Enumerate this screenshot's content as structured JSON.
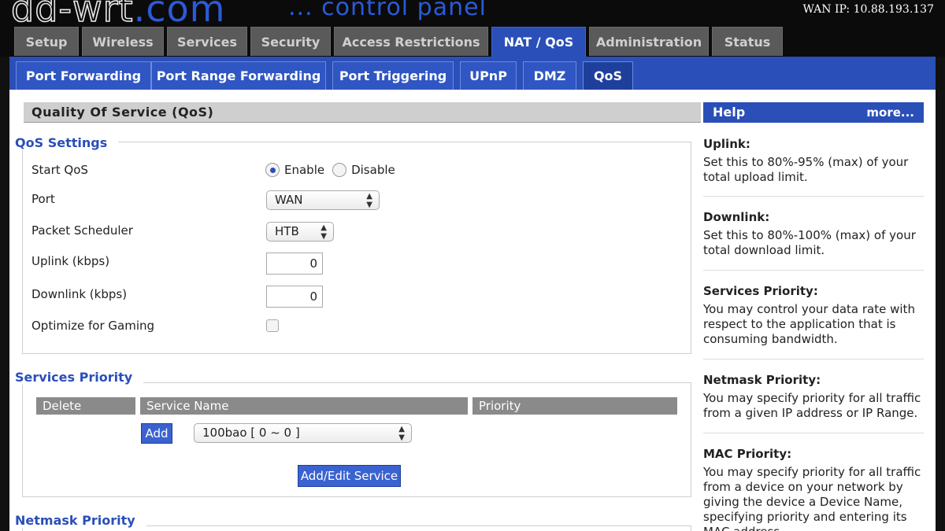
{
  "header": {
    "logo_dd": "dd-wrt",
    "logo_com": ".com",
    "title": "... control panel",
    "wan_ip": "WAN IP: 10.88.193.137"
  },
  "main_tabs": [
    "Setup",
    "Wireless",
    "Services",
    "Security",
    "Access Restrictions",
    "NAT / QoS",
    "Administration",
    "Status"
  ],
  "sub_tabs": [
    "Port Forwarding",
    "Port Range Forwarding",
    "Port Triggering",
    "UPnP",
    "DMZ",
    "QoS"
  ],
  "page_title": "Quality Of Service (QoS)",
  "qos": {
    "legend": "QoS Settings",
    "start_label": "Start QoS",
    "enable_label": "Enable",
    "disable_label": "Disable",
    "port_label": "Port",
    "port_value": "WAN",
    "scheduler_label": "Packet Scheduler",
    "scheduler_value": "HTB",
    "uplink_label": "Uplink (kbps)",
    "uplink_value": "0",
    "downlink_label": "Downlink (kbps)",
    "downlink_value": "0",
    "gaming_label": "Optimize for Gaming"
  },
  "services": {
    "legend": "Services Priority",
    "col_delete": "Delete",
    "col_service": "Service Name",
    "col_priority": "Priority",
    "add_label": "Add",
    "service_value": "100bao [ 0 ~ 0 ]",
    "add_edit_label": "Add/Edit Service"
  },
  "netmask": {
    "legend": "Netmask Priority"
  },
  "help": {
    "title": "Help",
    "more": "more...",
    "items": [
      {
        "title": "Uplink:",
        "text": "Set this to 80%-95% (max) of your total upload limit."
      },
      {
        "title": "Downlink:",
        "text": "Set this to 80%-100% (max) of your total download limit."
      },
      {
        "title": "Services Priority:",
        "text": "You may control your data rate with respect to the application that is consuming bandwidth."
      },
      {
        "title": "Netmask Priority:",
        "text": "You may specify priority for all traffic from a given IP address or IP Range."
      },
      {
        "title": "MAC Priority:",
        "text": "You may specify priority for all traffic from a device on your network by giving the device a Device Name, specifying priority and entering its MAC address."
      }
    ]
  }
}
